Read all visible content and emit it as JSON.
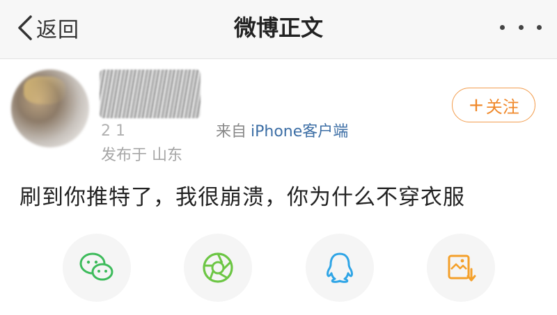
{
  "header": {
    "back_label": "返回",
    "title": "微博正文"
  },
  "post": {
    "time_partial": "2          1",
    "source_prefix": "来自",
    "source": "iPhone客户端",
    "location": "发布于 山东",
    "follow_label": "关注",
    "follow_plus": "+",
    "text": "刷到你推特了，我很崩溃，你为什么不穿衣服"
  },
  "share": {
    "icons": [
      "wechat-icon",
      "moments-icon",
      "qq-icon",
      "save-image-icon"
    ]
  },
  "colors": {
    "accent_orange": "#f0882a",
    "link_blue": "#3c6ea5",
    "wechat_green": "#3dbb5b",
    "moments_green": "#6cc644",
    "qq_blue": "#2fa5e6",
    "save_orange": "#f4a02a"
  }
}
